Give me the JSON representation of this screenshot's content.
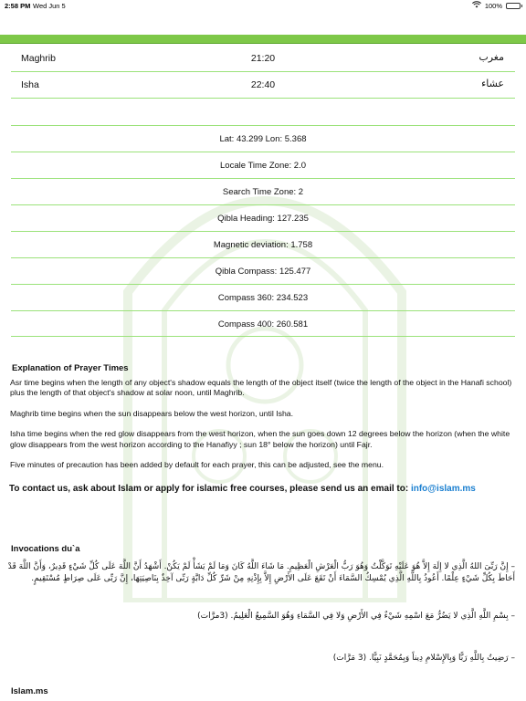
{
  "status": {
    "time": "2:58 PM",
    "date": "Wed Jun 5",
    "battery": "100%",
    "battery_level": 1.0
  },
  "prayers": [
    {
      "name": "Maghrib",
      "time": "21:20",
      "arabic": "مغرب"
    },
    {
      "name": "Isha",
      "time": "22:40",
      "arabic": "عشاء"
    }
  ],
  "info": [
    "Lat: 43.299 Lon: 5.368",
    "Locale Time Zone: 2.0",
    "Search Time Zone: 2",
    "Qibla Heading: 127.235",
    "Magnetic deviation: 1.758",
    "Qibla Compass: 125.477",
    "Compass 360: 234.523",
    "Compass 400: 260.581"
  ],
  "explanation": {
    "title": "Explanation of Prayer Times",
    "paragraphs": [
      "Asr time begins when the length of any object's shadow equals the length of the object itself (twice the length of the object in the Hanafi school) plus the length of that object's shadow at solar noon, until Maghrib.",
      "Maghrib time begins when the sun disappears below the west horizon, until Isha.",
      "Isha time begins when the red glow disappears from the west horizon, when the sun goes down 12 degrees below the horizon (when the white glow disappears from the west horizon according to the Hanafiyy ; sun 18° below the horizon) until Fajr.",
      "Five minutes of precaution has been added by default for each prayer, this can be adjusted, see the menu."
    ]
  },
  "contact": {
    "text": "To contact us, ask about Islam or apply for islamic free courses, please send us an email to: ",
    "email": "info@islam.ms"
  },
  "invocations": {
    "title": "Invocations du`a",
    "duas": [
      "– إِنَّ رَبِّىَ اللهُ الَّذِي لا إِلَهَ إِلاَّ هُوَ عَلَيْهِ تَوَكَّلْتُ وَهُوَ رَبُّ الْعَرْشِ الْعَظِيمِ. مَا شَاءَ اللَّهُ كَانَ وَمَا لَمْ يَشَأْ لَمْ يَكُنْ. أَشْهَدُ أَنَّ اللَّهَ عَلَى كُلِّ شَيْءٍ قَدِيرٌ، وَأَنَّ اللَّهَ قَدْ أَحَاطَ بِكُلِّ شَيْءٍ عِلْمًا. أَعُوذُ بِاللَّهِ الَّذِي يُمْسِكُ السَّمَاءَ أَنْ تَقَعَ عَلَى الأَرْضِ إِلاَّ بِإِذْنِهِ مِنْ شَرِّ كُلِّ دَابَّةٍ رَبِّى آخِذٌ بِنَاصِيَتِهَا، إِنَّ رَبِّى عَلَى صِرَاطٍ مُسْتَقِيمٍ.",
      "– بِسْمِ اللَّهِ الَّذِي لا يَضُرُّ مَعَ اسْمِهِ شَيْءٌ فِي الأَرْضِ وَلا فِي السَّمَاءِ وَهُوَ السَّمِيعُ الْعَلِيمُ. (3مرَّات)",
      "– رَضِيتُ بِاللَّهِ رَبًّا وَبِالإِسْلامِ دِيناً وَبِمُحَمَّدٍ نَبِيًّا. (3 مَرَّات)"
    ]
  },
  "footer": {
    "title": "Islam.ms"
  },
  "colors": {
    "accent_green": "#7ec848",
    "row_line": "#9be27a",
    "link": "#1a7fd0"
  },
  "icons": [
    "wifi-icon",
    "battery-icon",
    "mosque-background-graphic"
  ]
}
